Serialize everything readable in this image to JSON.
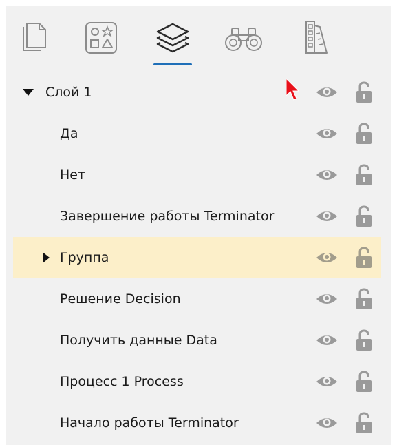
{
  "toolbar": {
    "tools": [
      {
        "name": "pages",
        "icon": "document-icon"
      },
      {
        "name": "shapes",
        "icon": "shapes-icon"
      },
      {
        "name": "layers",
        "icon": "layers-icon",
        "active": true
      },
      {
        "name": "find",
        "icon": "binoculars-icon"
      },
      {
        "name": "styles",
        "icon": "palette-swatch-icon"
      }
    ],
    "accent_color": "#1f6fb8"
  },
  "layers": {
    "root": {
      "label": "Слой 1",
      "expanded": true
    },
    "items": [
      {
        "label": "Да"
      },
      {
        "label": "Нет"
      },
      {
        "label": "Завершение работы Terminator"
      },
      {
        "label": "Группа",
        "selected": true,
        "collapsed_group": true
      },
      {
        "label": "Решение Decision"
      },
      {
        "label": "Получить данные Data"
      },
      {
        "label": "Процесс 1 Process"
      },
      {
        "label": "Начало работы Terminator"
      }
    ],
    "row_icons": {
      "visibility": "eye-icon",
      "lock": "unlock-icon"
    },
    "selected_color": "#fcefc9",
    "icon_color": "#9a9a9a"
  }
}
